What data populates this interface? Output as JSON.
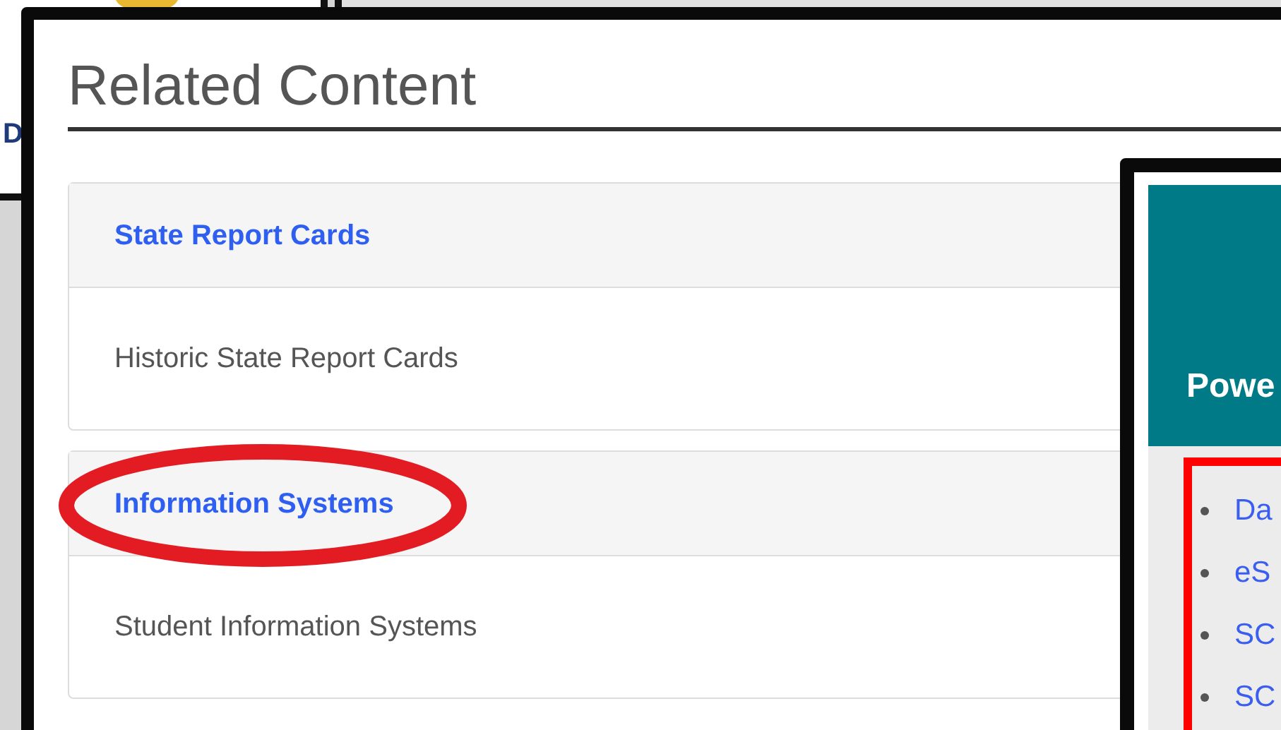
{
  "background_page": {
    "text": "D"
  },
  "related_content": {
    "title": "Related Content",
    "sections": [
      {
        "heading": "State Report Cards",
        "circled": false,
        "items": [
          "Historic State Report Cards"
        ]
      },
      {
        "heading": "Information Systems",
        "circled": true,
        "items": [
          "Student Information Systems"
        ]
      }
    ]
  },
  "side_panel": {
    "heading": "Powe",
    "links_boxed": true,
    "links": [
      "Da",
      "eS",
      "SC",
      "SC"
    ]
  }
}
